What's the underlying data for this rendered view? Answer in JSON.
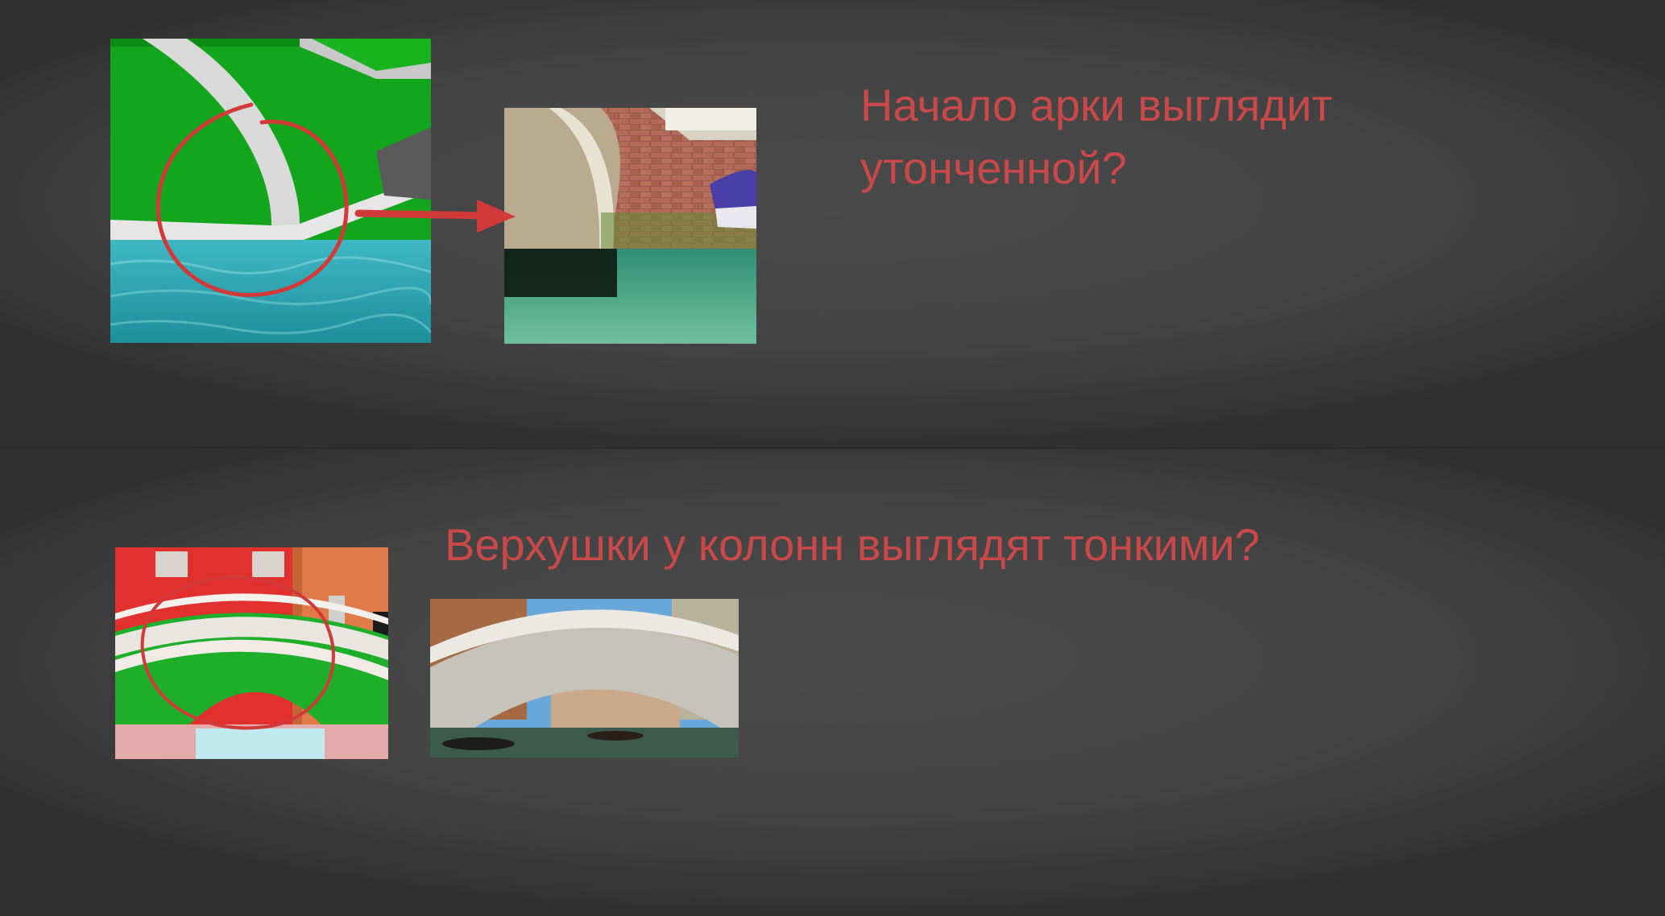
{
  "annotations": [
    {
      "text_lines": [
        "Начало арки выглядит",
        "утонченной?"
      ]
    },
    {
      "text_lines": [
        "Верхушки у колонн выглядят тонкими?"
      ]
    }
  ],
  "colors": {
    "background": "#2b2b2b",
    "panel": "#444444",
    "annotation_text": "#c9494a",
    "annotation_marker": "#d23a3a"
  },
  "icons": {
    "circle_marker_1": "circle-marker-icon",
    "circle_marker_2": "circle-marker-icon",
    "arrow": "arrow-right-icon"
  }
}
